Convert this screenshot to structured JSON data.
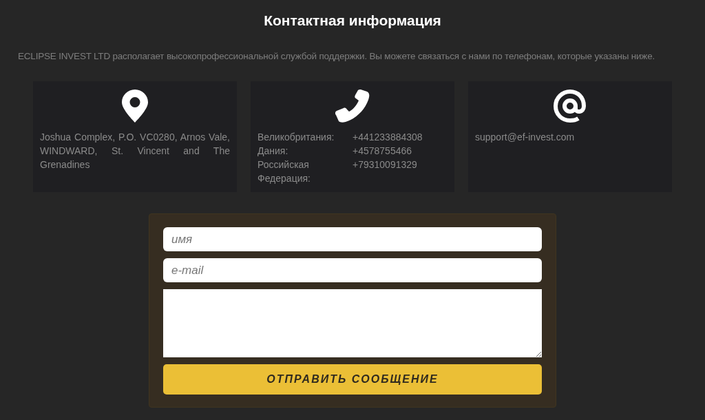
{
  "title": "Контактная информация",
  "intro": "ECLIPSE INVEST LTD располагает высокопрофессиональной службой поддержки. Вы можете связаться с нами по телефонам, которые указаны ниже.",
  "cards": [
    {
      "kind": "address",
      "text": "Joshua Complex, P.O. VC0280, Arnos Vale, WINDWARD, St. Vincent and The Grenadines"
    },
    {
      "kind": "phones",
      "rows": [
        {
          "country": "Великобритания:",
          "phone": "+441233884308"
        },
        {
          "country": "Дания:",
          "phone": "+4578755466"
        },
        {
          "country": "Российская Федерация:",
          "phone": "+79310091329"
        }
      ]
    },
    {
      "kind": "email",
      "text": "support@ef-invest.com"
    }
  ],
  "form": {
    "fields": [
      {
        "kind": "input",
        "placeholder": "имя"
      },
      {
        "kind": "input",
        "placeholder": "e-mail"
      },
      {
        "kind": "textarea"
      }
    ],
    "submit": "ОТПРАВИТЬ СООБЩЕНИЕ"
  }
}
